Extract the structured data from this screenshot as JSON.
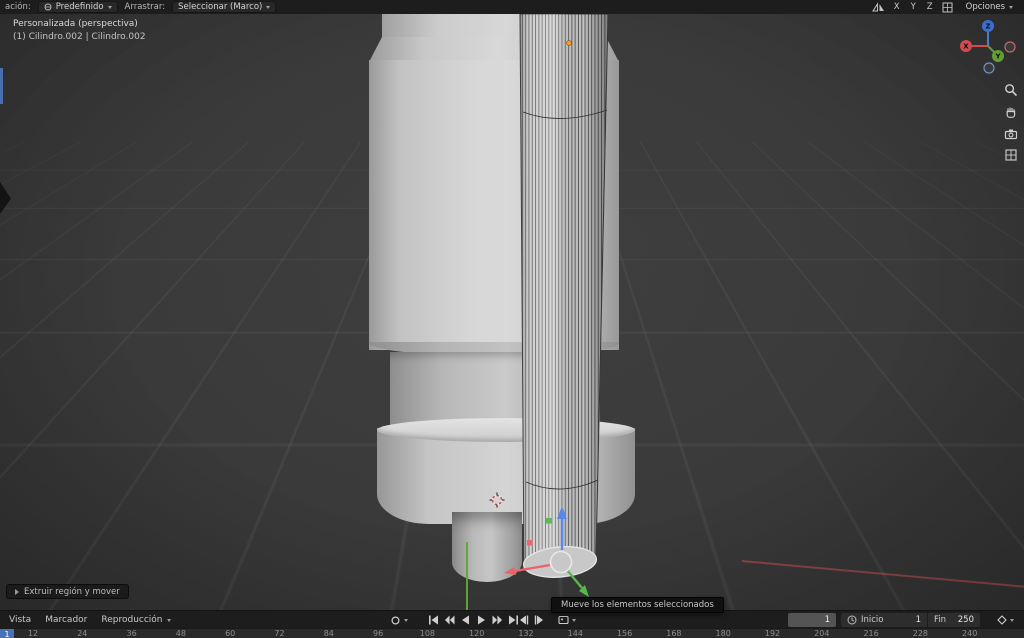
{
  "header": {
    "transform_label": "ación:",
    "preset_dropdown": "Predefinido",
    "drag_label": "Arrastrar:",
    "select_dropdown": "Seleccionar (Marco)",
    "mirror_axes": [
      "X",
      "Y",
      "Z"
    ],
    "options_label": "Opciones"
  },
  "viewport": {
    "view_label": "Personalizada (perspectiva)",
    "object_label": "(1) Cilindro.002 | Cilindro.002",
    "operator_panel_label": "Extruir región y mover",
    "nav_gizmo": {
      "x": "X",
      "y": "Y",
      "z": "Z"
    },
    "colors": {
      "axis_x": "#f0606a",
      "axis_y": "#57b84e",
      "axis_z": "#5a87e8",
      "selection_outline": "#e8e8e8",
      "origin_dot": "#ff9d2e",
      "playhead_blue": "#4772b3"
    }
  },
  "tooltip": "Mueve los elementos seleccionados",
  "timeline": {
    "menus": [
      "Vista",
      "Marcador",
      "Reproducción"
    ],
    "current_frame": "1",
    "start_label": "Inicio",
    "start_value": "1",
    "end_label": "Fin",
    "end_value": "250",
    "playhead_frame": "1",
    "ruler_frames": [
      12,
      24,
      36,
      48,
      60,
      72,
      84,
      96,
      108,
      120,
      132,
      144,
      156,
      168,
      180,
      192,
      204,
      216,
      228,
      240
    ]
  }
}
